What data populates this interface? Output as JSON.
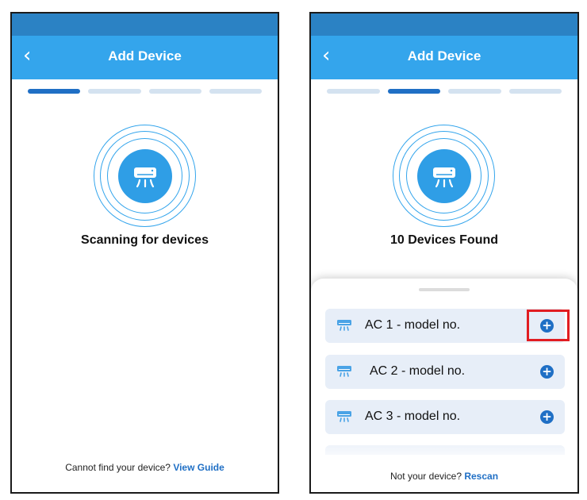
{
  "left_screen": {
    "title": "Add Device",
    "back_icon": "chevron-left-icon",
    "steps": [
      true,
      false,
      false,
      false
    ],
    "center_icon": "air-conditioner-icon",
    "headline": "Scanning for devices",
    "footer_text": "Cannot find your device?",
    "footer_link": "View Guide"
  },
  "right_screen": {
    "title": "Add Device",
    "back_icon": "chevron-left-icon",
    "steps": [
      false,
      true,
      false,
      false
    ],
    "center_icon": "air-conditioner-icon",
    "headline": "10 Devices Found",
    "devices": [
      {
        "name": "AC 1 - model no.",
        "icon": "air-conditioner-icon",
        "action_icon": "plus-circle-icon",
        "highlighted": true
      },
      {
        "name": "AC 2 - model no.",
        "icon": "air-conditioner-icon",
        "action_icon": "plus-circle-icon",
        "highlighted": false
      },
      {
        "name": "AC 3 - model no.",
        "icon": "air-conditioner-icon",
        "action_icon": "plus-circle-icon",
        "highlighted": false
      }
    ],
    "footer_text": "Not your device?",
    "footer_link": "Rescan"
  },
  "colors": {
    "status_bar": "#2b82c4",
    "app_bar": "#34a5ec",
    "accent": "#1f6fc5",
    "step_inactive": "#d4e2f0",
    "row_background": "#e7eef8",
    "highlight": "#e11d22"
  }
}
